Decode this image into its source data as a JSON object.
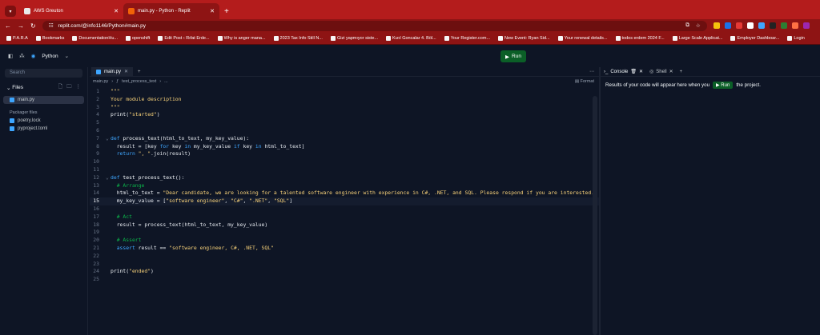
{
  "browser": {
    "tabs": [
      {
        "title": "AWS Greuton",
        "active": false
      },
      {
        "title": "main.py - Python - Replit",
        "active": true
      }
    ],
    "url": "replit.com/@info1146/Python#main.py",
    "bookmarks": [
      "P.A.R.A",
      "Bookmarks",
      "DocumentationHu...",
      "openshift",
      "Edit Post ‹ Rıfat Erde...",
      "Why is anger mana...",
      "2023 Tax Info Still N...",
      "Gizi yapmıyor siste...",
      "Kızıl Goncalar 4. Böl...",
      "Your Register.com...",
      "New Event: Ryan Sid...",
      "Your renewal details...",
      "todos erdem 2024 F...",
      "Large Scale Applicat...",
      "Employer Dashboar...",
      "Login"
    ]
  },
  "app": {
    "language": "Python",
    "run_label": "Run"
  },
  "sidebar": {
    "search_placeholder": "Search",
    "files_label": "Files",
    "files": [
      {
        "name": "main.py",
        "selected": true
      }
    ],
    "packager_label": "Packager files",
    "packager_files": [
      "poetry.lock",
      "pyproject.toml"
    ]
  },
  "editor": {
    "tab": "main.py",
    "breadcrumb": [
      "main.py",
      "test_process_text",
      "..."
    ],
    "format_label": "Format",
    "current_line": 15
  },
  "console": {
    "tabs": [
      "Console",
      "Shell"
    ],
    "message_before": "Results of your code will appear here when you",
    "run_label": "Run",
    "message_after": "the project."
  }
}
